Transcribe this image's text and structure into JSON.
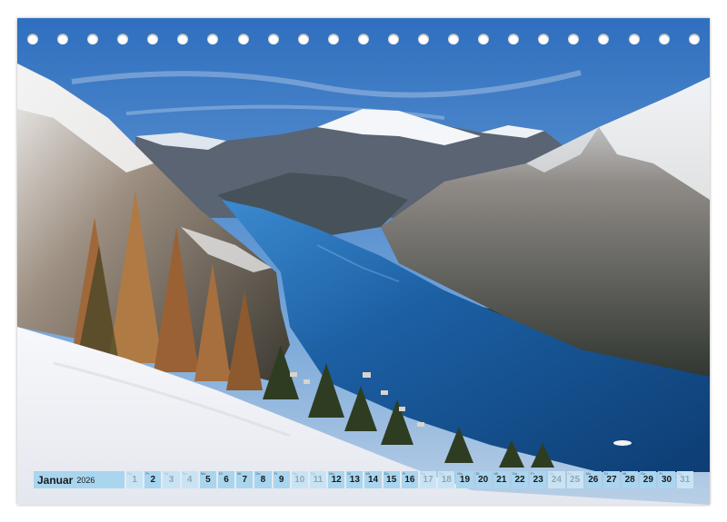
{
  "calendar": {
    "month": "Januar",
    "year": "2026",
    "days": [
      {
        "wd": "Do",
        "num": "1",
        "highlight": false
      },
      {
        "wd": "Fr",
        "num": "2",
        "highlight": true
      },
      {
        "wd": "Sa",
        "num": "3",
        "highlight": false
      },
      {
        "wd": "So",
        "num": "4",
        "highlight": false
      },
      {
        "wd": "Mo",
        "num": "5",
        "highlight": true
      },
      {
        "wd": "Di",
        "num": "6",
        "highlight": true
      },
      {
        "wd": "Mi",
        "num": "7",
        "highlight": true
      },
      {
        "wd": "Do",
        "num": "8",
        "highlight": true
      },
      {
        "wd": "Fr",
        "num": "9",
        "highlight": true
      },
      {
        "wd": "Sa",
        "num": "10",
        "highlight": false
      },
      {
        "wd": "So",
        "num": "11",
        "highlight": false
      },
      {
        "wd": "Mo",
        "num": "12",
        "highlight": true
      },
      {
        "wd": "Di",
        "num": "13",
        "highlight": true
      },
      {
        "wd": "Mi",
        "num": "14",
        "highlight": true
      },
      {
        "wd": "Do",
        "num": "15",
        "highlight": true
      },
      {
        "wd": "Fr",
        "num": "16",
        "highlight": true
      },
      {
        "wd": "Sa",
        "num": "17",
        "highlight": false
      },
      {
        "wd": "So",
        "num": "18",
        "highlight": false
      },
      {
        "wd": "Mo",
        "num": "19",
        "highlight": true
      },
      {
        "wd": "Di",
        "num": "20",
        "highlight": true
      },
      {
        "wd": "Mi",
        "num": "21",
        "highlight": true
      },
      {
        "wd": "Do",
        "num": "22",
        "highlight": true
      },
      {
        "wd": "Fr",
        "num": "23",
        "highlight": true
      },
      {
        "wd": "Sa",
        "num": "24",
        "highlight": false
      },
      {
        "wd": "So",
        "num": "25",
        "highlight": false
      },
      {
        "wd": "Mo",
        "num": "26",
        "highlight": true
      },
      {
        "wd": "Di",
        "num": "27",
        "highlight": true
      },
      {
        "wd": "Mi",
        "num": "28",
        "highlight": true
      },
      {
        "wd": "Do",
        "num": "29",
        "highlight": true
      },
      {
        "wd": "Fr",
        "num": "30",
        "highlight": true
      },
      {
        "wd": "Sa",
        "num": "31",
        "highlight": false
      }
    ]
  },
  "colors": {
    "strip": "#a9d5ef",
    "strip_faded": "#c8e4f4",
    "lake": "#1f5f9e",
    "sky": "#3b7cc4"
  },
  "binding_hole_count": 23
}
